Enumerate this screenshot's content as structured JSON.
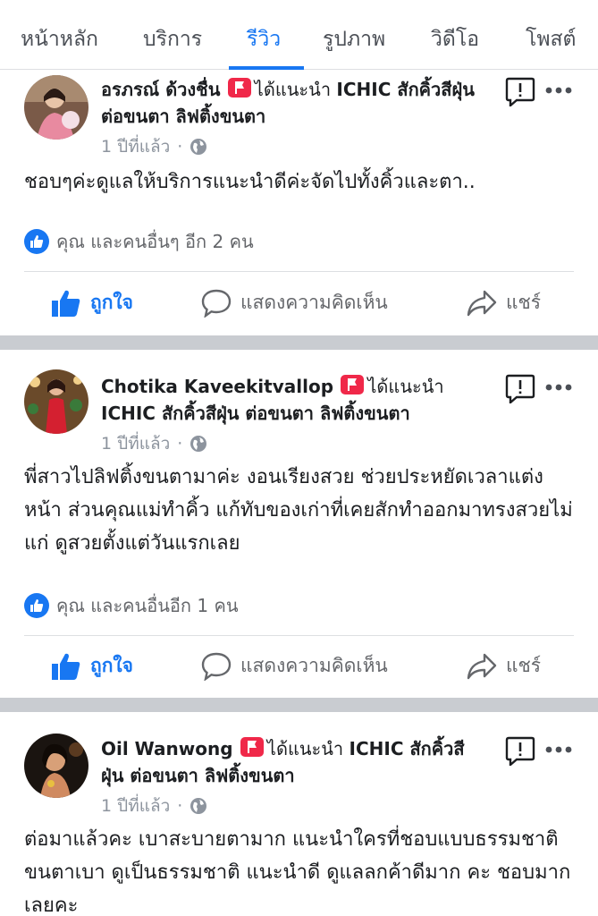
{
  "tabs": [
    {
      "label": "หน้าหลัก",
      "active": false
    },
    {
      "label": "บริการ",
      "active": false
    },
    {
      "label": "รีวิว",
      "active": true
    },
    {
      "label": "รูปภาพ",
      "active": false
    },
    {
      "label": "วิดีโอ",
      "active": false
    },
    {
      "label": "โพสต์",
      "active": false
    }
  ],
  "colors": {
    "accent": "#1877f2",
    "badge": "#f02849",
    "separator": "#c9ccd1"
  },
  "actions": {
    "like": "ถูกใจ",
    "comment": "แสดงความคิดเห็น",
    "share": "แชร์"
  },
  "posts": [
    {
      "author": "อรภรณ์ ด้วงชื่น",
      "recommend": "ได้แนะนำ",
      "page": "ICHIC สักคิ้วสีฝุ่น ต่อขนตา ลิฟติ้งขนตา",
      "time": "1 ปีที่แล้ว",
      "dot": "·",
      "body": "ชอบๆค่ะดูแลให้บริการแนะนำดีค่ะจัดไปทั้งคิ้วและตา..",
      "reactions": "คุณ และคนอื่นๆ อีก 2 คน"
    },
    {
      "author": "Chotika Kaveekitvallop",
      "recommend": "ได้แนะนำ",
      "page": "ICHIC สักคิ้วสีฝุ่น ต่อขนตา ลิฟติ้งขนตา",
      "time": "1 ปีที่แล้ว",
      "dot": "·",
      "body": "พี่สาวไปลิฟติ้งขนตามาค่ะ งอนเรียงสวย ช่วยประหยัดเวลาแต่งหน้า ส่วนคุณแม่ทำคิ้ว แก้ทับของเก่าที่เคยสักทำออกมาทรงสวยไม่แก่ ดูสวยตั้งแต่วันแรกเลย",
      "reactions": "คุณ และคนอื่นอีก 1 คน"
    },
    {
      "author": "Oil Wanwong",
      "recommend": "ได้แนะนำ",
      "page": "ICHIC สักคิ้วสีฝุ่น ต่อขนตา ลิฟติ้งขนตา",
      "time": "1 ปีที่แล้ว",
      "dot": "·",
      "body": "ต่อมาแล้วคะ เบาสะบายตามาก แนะนำใครที่ชอบแบบธรรมชาติ ขนตาเบา ดูเป็นธรรมชาติ แนะนำดี ดูแลลกค้าดีมาก คะ ชอบมากเลยคะ"
    }
  ]
}
